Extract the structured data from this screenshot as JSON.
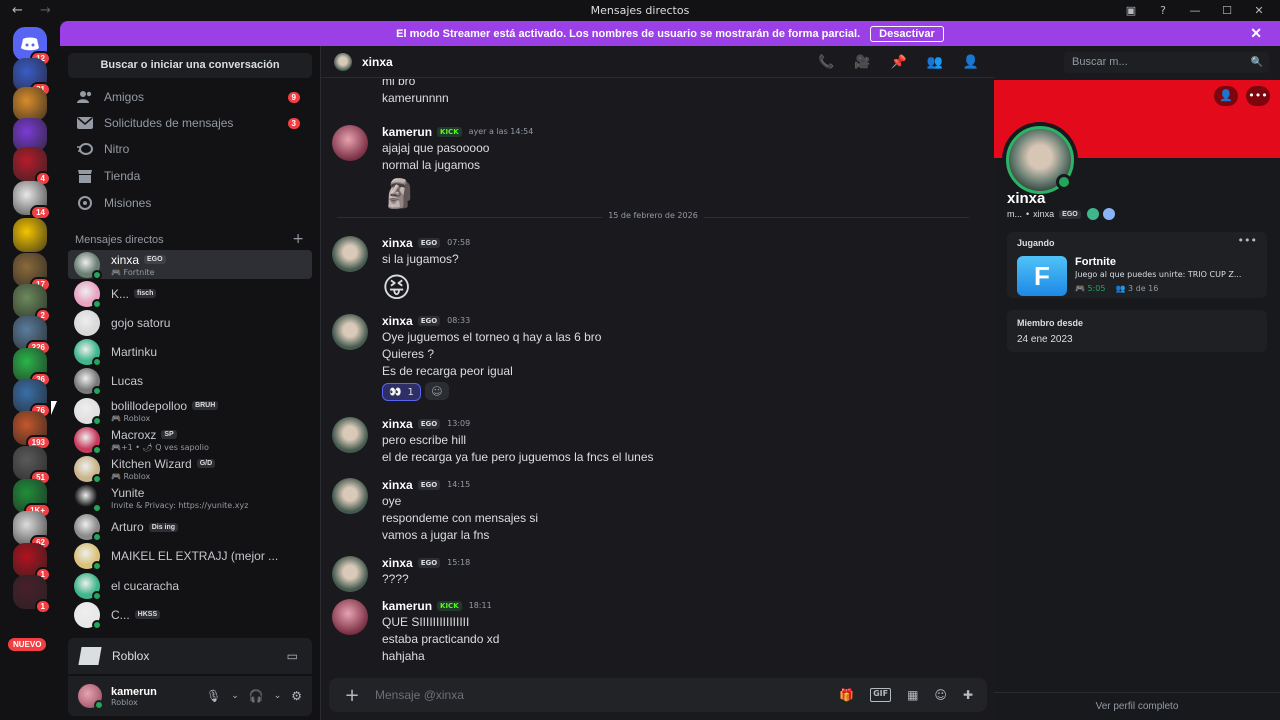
{
  "window": {
    "title": "Mensajes directos"
  },
  "banner": {
    "text": "El modo Streamer está activado. Los nombres de usuario se mostrarán de forma parcial.",
    "button": "Desactivar"
  },
  "rail": {
    "home_badge": "12",
    "servers": [
      {
        "badge": "31",
        "color": "#3b5cc9"
      },
      {
        "badge": "",
        "color": "#d98c2b"
      },
      {
        "badge": "",
        "color": "#7c3bd6"
      },
      {
        "badge": "4",
        "color": "#b51c2b"
      },
      {
        "badge": "14",
        "color": "#e8e8e8"
      },
      {
        "badge": "",
        "color": "#f5c400"
      },
      {
        "badge": "17",
        "color": "#8a6a3a"
      },
      {
        "badge": "2",
        "color": "#6c8a5c"
      },
      {
        "badge": "226",
        "color": "#5a7d9c"
      },
      {
        "badge": "36",
        "color": "#2ab54a"
      },
      {
        "badge": "76",
        "color": "#3a6fa8"
      },
      {
        "badge": "193",
        "color": "#c4572b"
      },
      {
        "badge": "51",
        "color": "#5a5a5a"
      },
      {
        "badge": "1K+",
        "color": "#1f8f3a"
      },
      {
        "badge": "62",
        "color": "#dcdcdc"
      },
      {
        "badge": "1",
        "color": "#b3121f"
      },
      {
        "badge": "1",
        "color": "#4a1f2a"
      }
    ],
    "nuevo": "NUEVO"
  },
  "sidebar": {
    "search": "Buscar o iniciar una conversación",
    "nav": [
      {
        "label": "Amigos",
        "badge": "9",
        "icon": "friends-icon"
      },
      {
        "label": "Solicitudes de mensajes",
        "badge": "3",
        "icon": "mail-icon"
      },
      {
        "label": "Nitro",
        "badge": "",
        "icon": "nitro-icon"
      },
      {
        "label": "Tienda",
        "badge": "",
        "icon": "shop-icon"
      },
      {
        "label": "Misiones",
        "badge": "",
        "icon": "quests-icon"
      }
    ],
    "dm_header": "Mensajes directos",
    "dms": [
      {
        "name": "xinxa",
        "tag": "EGO",
        "sub": "🎮 Fortnite",
        "status": "#23a55a",
        "avatar": "#6a7f74",
        "active": true
      },
      {
        "name": "K...",
        "tag": "fisch",
        "sub": "",
        "status": "#23a55a",
        "avatar": "#e8a3c0",
        "active": false
      },
      {
        "name": "gojo satoru",
        "tag": "",
        "sub": "",
        "status": "",
        "avatar": "#d9d9d9",
        "active": false
      },
      {
        "name": "Martinku",
        "tag": "",
        "sub": "",
        "status": "#23a55a",
        "avatar": "#3fb68b",
        "active": false
      },
      {
        "name": "Lucas",
        "tag": "",
        "sub": "",
        "status": "#23a55a",
        "avatar": "#7a7a7a",
        "active": false
      },
      {
        "name": "bolillodepolloo",
        "tag": "BRUH",
        "sub": "🎮 Roblox",
        "status": "#23a55a",
        "avatar": "#e0e0e0",
        "active": false
      },
      {
        "name": "Macroxz",
        "tag": "SP",
        "sub": "🎮+1 • 🌶 Q ves sapolio",
        "status": "#23a55a",
        "avatar": "#c73b5c",
        "active": false
      },
      {
        "name": "Kitchen Wizard",
        "tag": "G/D",
        "sub": "🎮 Roblox",
        "status": "#23a55a",
        "avatar": "#c9b58a",
        "active": false
      },
      {
        "name": "Yunite",
        "tag": "",
        "sub": "Invite & Privacy: https://yunite.xyz",
        "status": "#23a55a",
        "avatar": "#121214",
        "active": false
      },
      {
        "name": "Arturo",
        "tag": "Dis ing",
        "sub": "",
        "status": "#23a55a",
        "avatar": "#8a8a8a",
        "active": false
      },
      {
        "name": "MAIKEL EL EXTRAJJ (mejor ...",
        "tag": "",
        "sub": "",
        "status": "#23a55a",
        "avatar": "#d9c27a",
        "active": false
      },
      {
        "name": "el cucaracha",
        "tag": "",
        "sub": "",
        "status": "#23a55a",
        "avatar": "#3fb68b",
        "active": false
      },
      {
        "name": "C...",
        "tag": "HKSS",
        "sub": "",
        "status": "#23a55a",
        "avatar": "#e8e8e8",
        "active": false
      }
    ],
    "activity": "Roblox",
    "user": {
      "name": "kamerun",
      "status": "Roblox"
    }
  },
  "chat": {
    "recipient": "xinxa",
    "search_placeholder": "Buscar m...",
    "date_divider": "15 de febrero de 2026",
    "top_lines": [
      "mi bro",
      "kamerunnnn"
    ],
    "messages": [
      {
        "author": "kamerun",
        "tag": "KICK",
        "time": "ayer a las 14:54",
        "lines": [
          "ajajaj que pasooooo",
          "normal la jugamos"
        ],
        "emoji": "🗿",
        "avatar": "kam"
      },
      {
        "author": "xinxa",
        "tag": "EGO",
        "time": "07:58",
        "lines": [
          "si la jugamos?"
        ],
        "emoji": "😝",
        "avatar": "xin"
      },
      {
        "author": "xinxa",
        "tag": "EGO",
        "time": "08:33",
        "lines": [
          "Oye juguemos el torneo q hay a las 6 bro",
          "Quieres ?",
          "Es de recarga peor igual"
        ],
        "reaction": "👀",
        "reaction_count": "1",
        "avatar": "xin"
      },
      {
        "author": "xinxa",
        "tag": "EGO",
        "time": "13:09",
        "lines": [
          "pero escribe hill",
          "el de recarga ya fue pero juguemos la fncs el lunes"
        ],
        "avatar": "xin"
      },
      {
        "author": "xinxa",
        "tag": "EGO",
        "time": "14:15",
        "lines": [
          "oye",
          "respondeme con mensajes si",
          "vamos a jugar la fns"
        ],
        "avatar": "xin"
      },
      {
        "author": "xinxa",
        "tag": "EGO",
        "time": "15:18",
        "lines": [
          "????"
        ],
        "avatar": "xin"
      },
      {
        "author": "kamerun",
        "tag": "KICK",
        "time": "18:11",
        "lines": [
          "QUE SIIIIIIIIIIIIIII",
          "estaba practicando xd",
          "hahjaha"
        ],
        "avatar": "kam"
      }
    ],
    "composer_placeholder": "Mensaje @xinxa"
  },
  "profile": {
    "name": "xinxa",
    "sub_prefix": "m...",
    "sub_user": "xinxa",
    "tag": "EGO",
    "playing_title": "Jugando",
    "game": {
      "name": "Fortnite",
      "letter": "F",
      "desc": "Juego al que puedes unirte: TRIO CUP Z...",
      "time": "5:05",
      "party": "3 de 16"
    },
    "member_title": "Miembro desde",
    "member_date": "24 ene 2023",
    "full_profile": "Ver perfil completo"
  }
}
